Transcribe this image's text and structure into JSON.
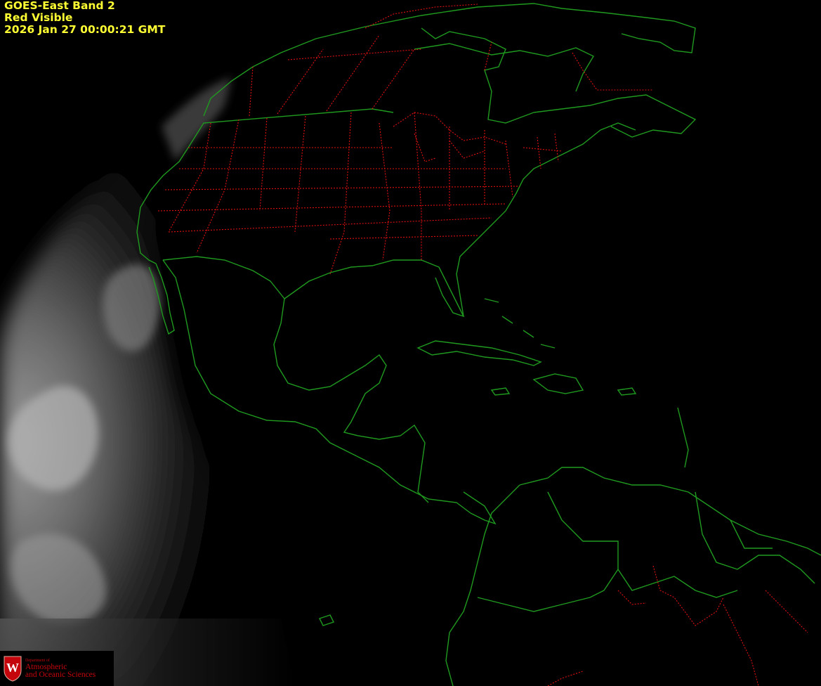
{
  "header": {
    "line1": "GOES-East Band 2",
    "line2": "Red Visible",
    "line3": "2026 Jan 27  00:00:21 GMT"
  },
  "logo": {
    "crest_letter": "W",
    "dept_small": "Department of",
    "dept_line1": "Atmospheric",
    "dept_line2": "and Oceanic Sciences"
  },
  "colors": {
    "caption": "#ffff33",
    "coastline": "#1f9a1f",
    "state_borders": "#e01010",
    "background": "#000000",
    "logo_red": "#c5050c"
  }
}
